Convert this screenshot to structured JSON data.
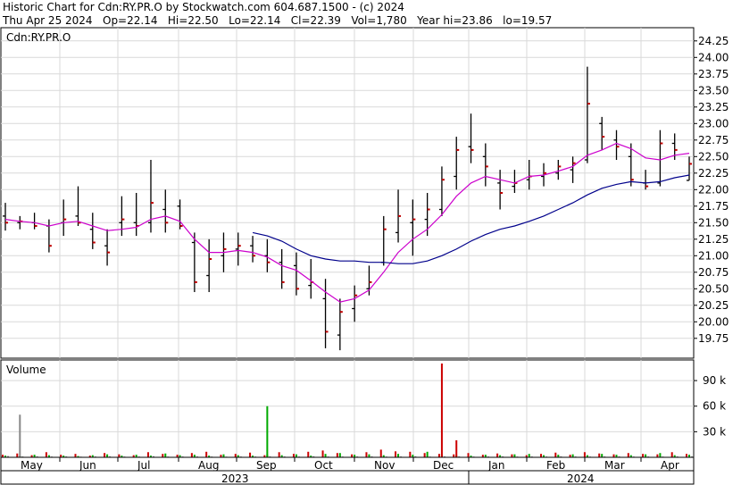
{
  "header": {
    "line1": "Historic Chart for Cdn:RY.PR.O by Stockwatch.com 604.687.1500 - (c) 2024",
    "line2": "Thu Apr 25 2024   Op=22.14   Hi=22.50   Lo=22.14   Cl=22.39   Vol=1,780   Year hi=23.86   lo=19.57"
  },
  "chart_data": [
    {
      "type": "bar",
      "symbol": "Cdn:RY.PR.O",
      "ylim": [
        19.45,
        24.45
      ],
      "yticks": [
        "24.25",
        "24.00",
        "23.75",
        "23.50",
        "23.25",
        "23.00",
        "22.75",
        "22.50",
        "22.25",
        "22.00",
        "21.75",
        "21.50",
        "21.25",
        "21.00",
        "20.75",
        "20.50",
        "20.25",
        "20.00",
        "19.75"
      ],
      "months": [
        "May",
        "Jun",
        "Jul",
        "Aug",
        "Sep",
        "Oct",
        "Nov",
        "Dec",
        "Jan",
        "Feb",
        "Mar",
        "Apr"
      ],
      "years": [
        "2023",
        "2024"
      ],
      "grid": true,
      "ohlc_week": [
        {
          "week": "May w1",
          "open": 21.6,
          "high": 21.8,
          "low": 21.38,
          "close": 21.5
        },
        {
          "week": "May w2",
          "open": 21.5,
          "high": 21.6,
          "low": 21.4,
          "close": 21.52
        },
        {
          "week": "May w3",
          "open": 21.5,
          "high": 21.65,
          "low": 21.4,
          "close": 21.45
        },
        {
          "week": "May w4",
          "open": 21.45,
          "high": 21.55,
          "low": 21.05,
          "close": 21.15
        },
        {
          "week": "Jun w1",
          "open": 21.5,
          "high": 21.85,
          "low": 21.3,
          "close": 21.55
        },
        {
          "week": "Jun w2",
          "open": 21.6,
          "high": 22.05,
          "low": 21.45,
          "close": 21.5
        },
        {
          "week": "Jun w3",
          "open": 21.4,
          "high": 21.65,
          "low": 21.1,
          "close": 21.2
        },
        {
          "week": "Jun w4",
          "open": 21.15,
          "high": 21.4,
          "low": 20.85,
          "close": 21.05
        },
        {
          "week": "Jul w1",
          "open": 21.5,
          "high": 21.9,
          "low": 21.3,
          "close": 21.55
        },
        {
          "week": "Jul w2",
          "open": 21.5,
          "high": 21.95,
          "low": 21.3,
          "close": 21.45
        },
        {
          "week": "Jul w3",
          "open": 21.5,
          "high": 22.45,
          "low": 21.35,
          "close": 21.8
        },
        {
          "week": "Jul w4",
          "open": 21.7,
          "high": 22.0,
          "low": 21.35,
          "close": 21.5
        },
        {
          "week": "Aug w1",
          "open": 21.75,
          "high": 21.85,
          "low": 21.4,
          "close": 21.45
        },
        {
          "week": "Aug w2",
          "open": 21.2,
          "high": 21.35,
          "low": 20.45,
          "close": 20.6
        },
        {
          "week": "Aug w3",
          "open": 20.7,
          "high": 21.25,
          "low": 20.45,
          "close": 20.95
        },
        {
          "week": "Aug w4",
          "open": 21.0,
          "high": 21.35,
          "low": 20.75,
          "close": 21.1
        },
        {
          "week": "Sep w1",
          "open": 21.1,
          "high": 21.35,
          "low": 20.85,
          "close": 21.15
        },
        {
          "week": "Sep w2",
          "open": 21.15,
          "high": 21.3,
          "low": 20.9,
          "close": 21.0
        },
        {
          "week": "Sep w3",
          "open": 21.0,
          "high": 21.25,
          "low": 20.75,
          "close": 20.9
        },
        {
          "week": "Sep w4",
          "open": 20.9,
          "high": 21.1,
          "low": 20.5,
          "close": 20.6
        },
        {
          "week": "Oct w1",
          "open": 20.85,
          "high": 21.05,
          "low": 20.4,
          "close": 20.5
        },
        {
          "week": "Oct w2",
          "open": 20.55,
          "high": 20.95,
          "low": 20.35,
          "close": 20.6
        },
        {
          "week": "Oct w3",
          "open": 20.35,
          "high": 20.65,
          "low": 19.6,
          "close": 19.85
        },
        {
          "week": "Oct w4",
          "open": 19.8,
          "high": 20.35,
          "low": 19.57,
          "close": 20.15
        },
        {
          "week": "Nov w1",
          "open": 20.2,
          "high": 20.55,
          "low": 20.0,
          "close": 20.4
        },
        {
          "week": "Nov w2",
          "open": 20.5,
          "high": 20.85,
          "low": 20.4,
          "close": 20.6
        },
        {
          "week": "Nov w3",
          "open": 20.9,
          "high": 21.6,
          "low": 20.85,
          "close": 21.4
        },
        {
          "week": "Nov w4",
          "open": 21.35,
          "high": 22.0,
          "low": 21.2,
          "close": 21.6
        },
        {
          "week": "Dec w1",
          "open": 21.5,
          "high": 21.85,
          "low": 21.0,
          "close": 21.55
        },
        {
          "week": "Dec w2",
          "open": 21.55,
          "high": 21.95,
          "low": 21.3,
          "close": 21.7
        },
        {
          "week": "Dec w3",
          "open": 21.7,
          "high": 22.35,
          "low": 21.6,
          "close": 22.15
        },
        {
          "week": "Dec w4",
          "open": 22.2,
          "high": 22.8,
          "low": 22.0,
          "close": 22.6
        },
        {
          "week": "Jan w1",
          "open": 22.65,
          "high": 23.15,
          "low": 22.4,
          "close": 22.6
        },
        {
          "week": "Jan w2",
          "open": 22.5,
          "high": 22.7,
          "low": 22.05,
          "close": 22.35
        },
        {
          "week": "Jan w3",
          "open": 22.1,
          "high": 22.3,
          "low": 21.7,
          "close": 21.95
        },
        {
          "week": "Jan w4",
          "open": 22.05,
          "high": 22.3,
          "low": 21.95,
          "close": 22.1
        },
        {
          "week": "Feb w1",
          "open": 22.15,
          "high": 22.45,
          "low": 22.0,
          "close": 22.2
        },
        {
          "week": "Feb w2",
          "open": 22.2,
          "high": 22.4,
          "low": 22.05,
          "close": 22.25
        },
        {
          "week": "Feb w3",
          "open": 22.25,
          "high": 22.45,
          "low": 22.15,
          "close": 22.35
        },
        {
          "week": "Feb w4",
          "open": 22.3,
          "high": 22.5,
          "low": 22.1,
          "close": 22.4
        },
        {
          "week": "Mar w1",
          "open": 22.45,
          "high": 23.86,
          "low": 22.4,
          "close": 23.3
        },
        {
          "week": "Mar w2",
          "open": 23.0,
          "high": 23.1,
          "low": 22.6,
          "close": 22.8
        },
        {
          "week": "Mar w3",
          "open": 22.75,
          "high": 22.9,
          "low": 22.45,
          "close": 22.65
        },
        {
          "week": "Mar w4",
          "open": 22.5,
          "high": 22.7,
          "low": 22.05,
          "close": 22.15
        },
        {
          "week": "Apr w1",
          "open": 22.1,
          "high": 22.3,
          "low": 22.0,
          "close": 22.05
        },
        {
          "week": "Apr w2",
          "open": 22.1,
          "high": 22.9,
          "low": 22.05,
          "close": 22.7
        },
        {
          "week": "Apr w3",
          "open": 22.7,
          "high": 22.85,
          "low": 22.45,
          "close": 22.6
        },
        {
          "week": "Apr w4",
          "open": 22.14,
          "high": 22.5,
          "low": 22.14,
          "close": 22.39
        }
      ],
      "series": [
        {
          "name": "",
          "color": "#cc00cc",
          "values": [
            21.55,
            21.52,
            21.5,
            21.45,
            21.5,
            21.52,
            21.45,
            21.38,
            21.4,
            21.43,
            21.55,
            21.6,
            21.52,
            21.25,
            21.05,
            21.05,
            21.08,
            21.05,
            20.98,
            20.85,
            20.78,
            20.62,
            20.45,
            20.3,
            20.35,
            20.48,
            20.75,
            21.05,
            21.25,
            21.4,
            21.62,
            21.9,
            22.1,
            22.2,
            22.15,
            22.1,
            22.2,
            22.22,
            22.28,
            22.35,
            22.52,
            22.6,
            22.7,
            22.62,
            22.48,
            22.45,
            22.52,
            22.55
          ]
        },
        {
          "name": "",
          "color": "#00008b",
          "values": [
            null,
            null,
            null,
            null,
            null,
            null,
            null,
            null,
            null,
            null,
            null,
            null,
            null,
            null,
            null,
            null,
            null,
            21.35,
            21.3,
            21.22,
            21.1,
            21.0,
            20.95,
            20.92,
            20.92,
            20.9,
            20.9,
            20.88,
            20.88,
            20.92,
            21.0,
            21.1,
            21.22,
            21.32,
            21.4,
            21.45,
            21.52,
            21.6,
            21.7,
            21.8,
            21.92,
            22.02,
            22.08,
            22.12,
            22.1,
            22.12,
            22.18,
            22.22
          ]
        }
      ]
    },
    {
      "type": "bar",
      "title": "Volume",
      "ylim": [
        0,
        110000
      ],
      "yticks": [
        "90 k",
        "60 k",
        "30 k"
      ],
      "series": [
        {
          "name": "",
          "color": "#cc0000",
          "values": [
            3000,
            4500,
            2500,
            6000,
            3000,
            4000,
            2000,
            5000,
            3500,
            2500,
            6000,
            4000,
            3000,
            5000,
            6500,
            3000,
            4000,
            5500,
            2500,
            6000,
            4000,
            6500,
            8000,
            5000,
            3500,
            6000,
            9000,
            7000,
            6500,
            5000,
            4000,
            3500,
            5000,
            3000,
            4500,
            3500,
            2500,
            4000,
            5500,
            3000,
            6000,
            4500,
            3500,
            5000,
            4000,
            3500,
            6000,
            4000
          ]
        },
        {
          "name": "",
          "color": "#00aa00",
          "values": [
            2000,
            1500,
            3000,
            2500,
            2000,
            1500,
            2500,
            3500,
            2000,
            3000,
            2000,
            4500,
            2500,
            3000,
            2000,
            3500,
            2500,
            2000,
            3000,
            2500,
            3500,
            2000,
            4000,
            5000,
            3000,
            3500,
            2500,
            4000,
            3000,
            6500,
            3500,
            2500,
            2000,
            3000,
            2500,
            3500,
            4000,
            2500,
            3000,
            3500,
            2500,
            4000,
            3000,
            2500,
            3500,
            5000,
            2500,
            3000
          ]
        },
        {
          "name": "",
          "color": "#888888",
          "values": [
            1500,
            1000,
            1200,
            900,
            1100,
            800,
            1000,
            1200,
            900,
            1000,
            1300,
            900,
            1000,
            1100,
            900,
            800,
            1000,
            900,
            1100,
            1000,
            900,
            1200,
            1000,
            900,
            1000,
            1100,
            900,
            1000,
            1200,
            900,
            1000,
            1100,
            900,
            1000,
            1100,
            900,
            1000,
            900,
            1100,
            1000,
            900,
            1000,
            1100,
            900,
            1000,
            900,
            1100,
            1000
          ]
        }
      ],
      "spikes": [
        {
          "week": 1,
          "value": 50000,
          "color": "#888888"
        },
        {
          "week": 18,
          "value": 60000,
          "color": "#00aa00"
        },
        {
          "week": 30,
          "value": 115000,
          "color": "#cc0000"
        },
        {
          "week": 31,
          "value": 20000,
          "color": "#cc0000"
        }
      ]
    }
  ]
}
